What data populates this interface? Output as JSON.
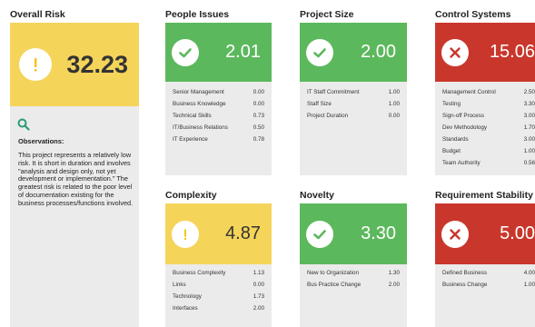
{
  "overall": {
    "title": "Overall Risk",
    "score": "32.23",
    "icon": "exclamation-icon",
    "color": "#f5d45a",
    "observations_label": "Observations:",
    "observations_text": "This project represents a relatively low risk. It is short in duration and involves \"analysis and design only, not yet development or implementation.\" The greatest risk is related to the poor level of documentation existing for the business processes/functions involved."
  },
  "people": {
    "title": "People Issues",
    "score": "2.01",
    "icon": "check-icon",
    "color": "#5cb85c",
    "rows": [
      {
        "label": "Senior Management",
        "value": "0.00"
      },
      {
        "label": "Business Knowledge",
        "value": "0.00"
      },
      {
        "label": "Technical Skills",
        "value": "0.73"
      },
      {
        "label": "IT/Business Relations",
        "value": "0.50"
      },
      {
        "label": "IT Experience",
        "value": "0.78"
      }
    ]
  },
  "size": {
    "title": "Project Size",
    "score": "2.00",
    "icon": "check-icon",
    "color": "#5cb85c",
    "rows": [
      {
        "label": "IT Staff Commitment",
        "value": "1.00"
      },
      {
        "label": "Staff Size",
        "value": "1.00"
      },
      {
        "label": "Project Duration",
        "value": "0.00"
      }
    ]
  },
  "control": {
    "title": "Control Systems",
    "score": "15.06",
    "icon": "x-icon",
    "color": "#c9372c",
    "rows": [
      {
        "label": "Management Control",
        "value": "2.50"
      },
      {
        "label": "Testing",
        "value": "3.30"
      },
      {
        "label": "Sign-off Process",
        "value": "3.00"
      },
      {
        "label": "Dev Methodology",
        "value": "1.70"
      },
      {
        "label": "Standards",
        "value": "3.00"
      },
      {
        "label": "Budget",
        "value": "1.00"
      },
      {
        "label": "Team Authority",
        "value": "0.56"
      }
    ]
  },
  "complexity": {
    "title": "Complexity",
    "score": "4.87",
    "icon": "exclamation-icon",
    "color": "#f5d45a",
    "rows": [
      {
        "label": "Business Complexity",
        "value": "1.13"
      },
      {
        "label": "Links",
        "value": "0.00"
      },
      {
        "label": "Technology",
        "value": "1.73"
      },
      {
        "label": "Interfaces",
        "value": "2.00"
      }
    ]
  },
  "novelty": {
    "title": "Novelty",
    "score": "3.30",
    "icon": "check-icon",
    "color": "#5cb85c",
    "rows": [
      {
        "label": "New to Organization",
        "value": "1.30"
      },
      {
        "label": "Bus Practice Change",
        "value": "2.00"
      }
    ]
  },
  "stability": {
    "title": "Requirement Stability",
    "score": "5.00",
    "icon": "x-icon",
    "color": "#c9372c",
    "rows": [
      {
        "label": "Defined Business",
        "value": "4.00"
      },
      {
        "label": "Business Change",
        "value": "1.00"
      }
    ]
  }
}
